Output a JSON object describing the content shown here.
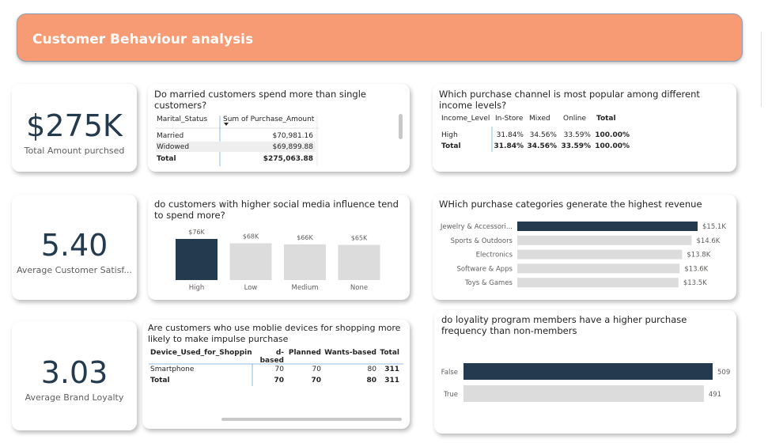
{
  "header": {
    "title": "Customer Behaviour analysis"
  },
  "kpis": [
    {
      "value": "$275K",
      "label": "Total Amount purchsed"
    },
    {
      "value": "5.40",
      "label": "Average Customer Satisf..."
    },
    {
      "value": "3.03",
      "label": "Average Brand Loyalty"
    }
  ],
  "marital": {
    "title": "Do married customers spend more than single customers?",
    "col1": "Marital_Status",
    "col2": "Sum of Purchase_Amount",
    "rows": [
      {
        "label": "Married",
        "value": "$70,981.16"
      },
      {
        "label": "Widowed",
        "value": "$69,899.88"
      }
    ],
    "total_label": "Total",
    "total_value": "$275,063.88"
  },
  "channel": {
    "title": "Which purchase channel is most popular among different income levels?",
    "headers": [
      "Income_Level",
      "In-Store",
      "Mixed",
      "Online",
      "Total"
    ],
    "rows": [
      [
        "High",
        "31.84%",
        "34.56%",
        "33.59%",
        "100.00%"
      ],
      [
        "Total",
        "31.84%",
        "34.56%",
        "33.59%",
        "100.00%"
      ]
    ]
  },
  "social": {
    "title": "do customers with higher social media influence tend to spend more?",
    "chart_data": {
      "type": "bar",
      "categories": [
        "High",
        "Low",
        "Medium",
        "None"
      ],
      "values": [
        76,
        68,
        66,
        65
      ],
      "labels": [
        "$76K",
        "$68K",
        "$66K",
        "$65K"
      ],
      "highlight": "High",
      "ylabel": "",
      "xlabel": ""
    }
  },
  "categories": {
    "title": "WHich purchase categories generate the highest revenue",
    "chart_data": {
      "type": "bar",
      "orientation": "horizontal",
      "categories": [
        "Jewelry & Accessori...",
        "Sports & Outdoors",
        "Electronics",
        "Software & Apps",
        "Toys & Games"
      ],
      "values": [
        15.1,
        14.6,
        13.8,
        13.6,
        13.5
      ],
      "labels": [
        "$15.1K",
        "$14.6K",
        "$13.8K",
        "$13.6K",
        "$13.5K"
      ],
      "highlight": "Jewelry & Accessori..."
    }
  },
  "impulse": {
    "title": "Are customers who use moblie devices for shopping more likely to make impulse purchase",
    "headers": [
      "Device_Used_for_Shopping",
      "d-based",
      "Planned",
      "Wants-based",
      "Total"
    ],
    "rows": [
      [
        "Smartphone",
        "70",
        "70",
        "80",
        "311"
      ],
      [
        "Total",
        "70",
        "70",
        "80",
        "311"
      ]
    ]
  },
  "loyalty": {
    "title": "do loyality program members have a higher purchase frequency than non-members",
    "chart_data": {
      "type": "bar",
      "orientation": "horizontal",
      "categories": [
        "False",
        "True"
      ],
      "values": [
        509,
        491
      ],
      "labels": [
        "509",
        "491"
      ],
      "highlight": "False"
    }
  },
  "colors": {
    "dark": "#243a4e",
    "light": "#dcdcdc",
    "header": "#f69b74",
    "text": "#252423"
  }
}
